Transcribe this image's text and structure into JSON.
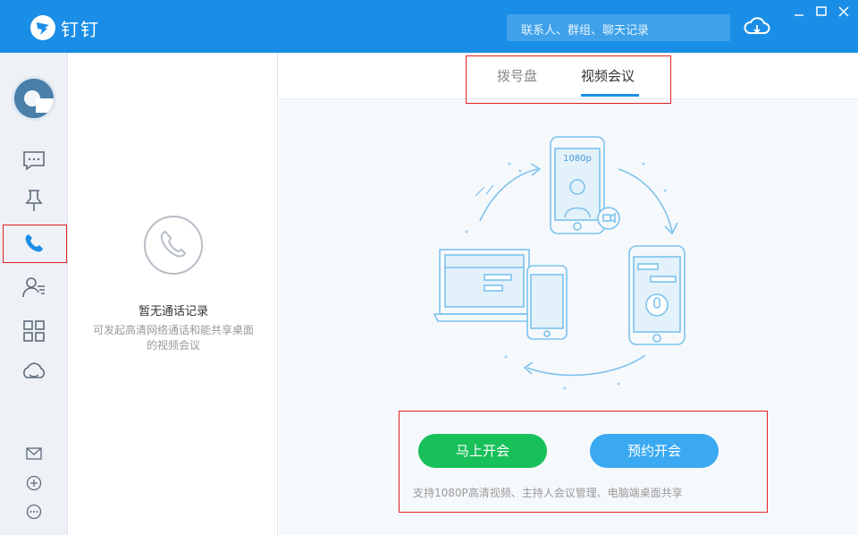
{
  "app": {
    "title": "钉钉"
  },
  "search": {
    "placeholder": "联系人、群组、聊天记录"
  },
  "calllist": {
    "empty_title": "暂无通话记录",
    "empty_desc": "可发起高清网络通话和能共享桌面的视频会议"
  },
  "tabs": [
    {
      "label": "拨号盘",
      "active": false
    },
    {
      "label": "视频会议",
      "active": true
    }
  ],
  "illustration": {
    "phone_badge": "1080p"
  },
  "actions": {
    "start_now": "马上开会",
    "schedule": "预约开会"
  },
  "footnote": "支持1080P高清视频、主持人会议管理、电脑端桌面共享",
  "colors": {
    "brand": "#1a8ee6",
    "start_button": "#18c05a",
    "schedule_button": "#3aa9f2"
  }
}
